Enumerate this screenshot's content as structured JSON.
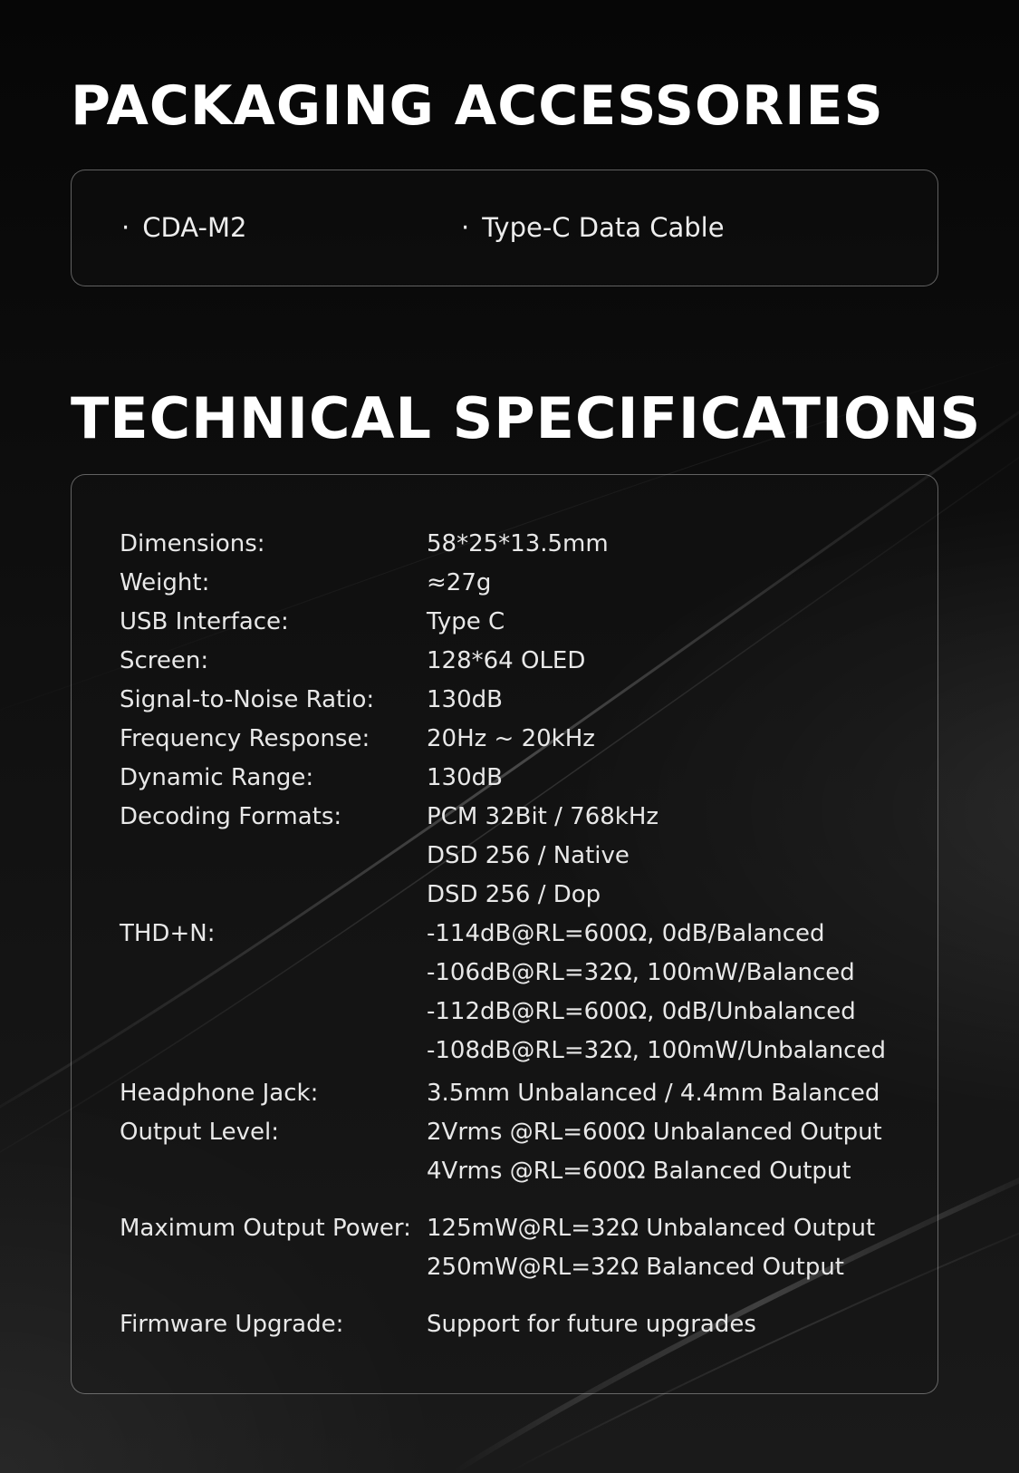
{
  "packaging": {
    "title": "PACKAGING ACCESSORIES",
    "bullet": "·",
    "items": [
      "CDA-M2",
      "Type-C Data Cable"
    ]
  },
  "specs": {
    "title": "TECHNICAL SPECIFICATIONS",
    "rows": [
      {
        "label": "Dimensions:",
        "values": [
          "58*25*13.5mm"
        ]
      },
      {
        "label": "Weight:",
        "values": [
          "≈27g"
        ]
      },
      {
        "label": "USB Interface:",
        "values": [
          "Type C"
        ]
      },
      {
        "label": "Screen:",
        "values": [
          "128*64 OLED"
        ]
      },
      {
        "label": "Signal-to-Noise Ratio:",
        "values": [
          "130dB"
        ]
      },
      {
        "label": "Frequency Response:",
        "values": [
          "20Hz ~ 20kHz"
        ]
      },
      {
        "label": "Dynamic Range:",
        "values": [
          "130dB"
        ]
      },
      {
        "label": "Decoding Formats:",
        "values": [
          "PCM 32Bit / 768kHz",
          "DSD 256 / Native",
          "DSD 256 / Dop"
        ]
      },
      {
        "label": "THD+N:",
        "values": [
          "-114dB@RL=600Ω, 0dB/Balanced",
          "-106dB@RL=32Ω, 100mW/Balanced",
          "-112dB@RL=600Ω, 0dB/Unbalanced",
          "-108dB@RL=32Ω, 100mW/Unbalanced"
        ]
      },
      {
        "label": "Headphone Jack:",
        "values": [
          "3.5mm Unbalanced / 4.4mm Balanced"
        ]
      },
      {
        "label": "Output Level:",
        "values": [
          "2Vrms @RL=600Ω Unbalanced Output",
          "4Vrms @RL=600Ω Balanced Output"
        ]
      },
      {
        "label": "Maximum Output Power:",
        "values": [
          "125mW@RL=32Ω Unbalanced Output",
          "250mW@RL=32Ω Balanced Output"
        ]
      },
      {
        "label": "Firmware Upgrade:",
        "values": [
          "Support for future upgrades"
        ]
      }
    ]
  }
}
